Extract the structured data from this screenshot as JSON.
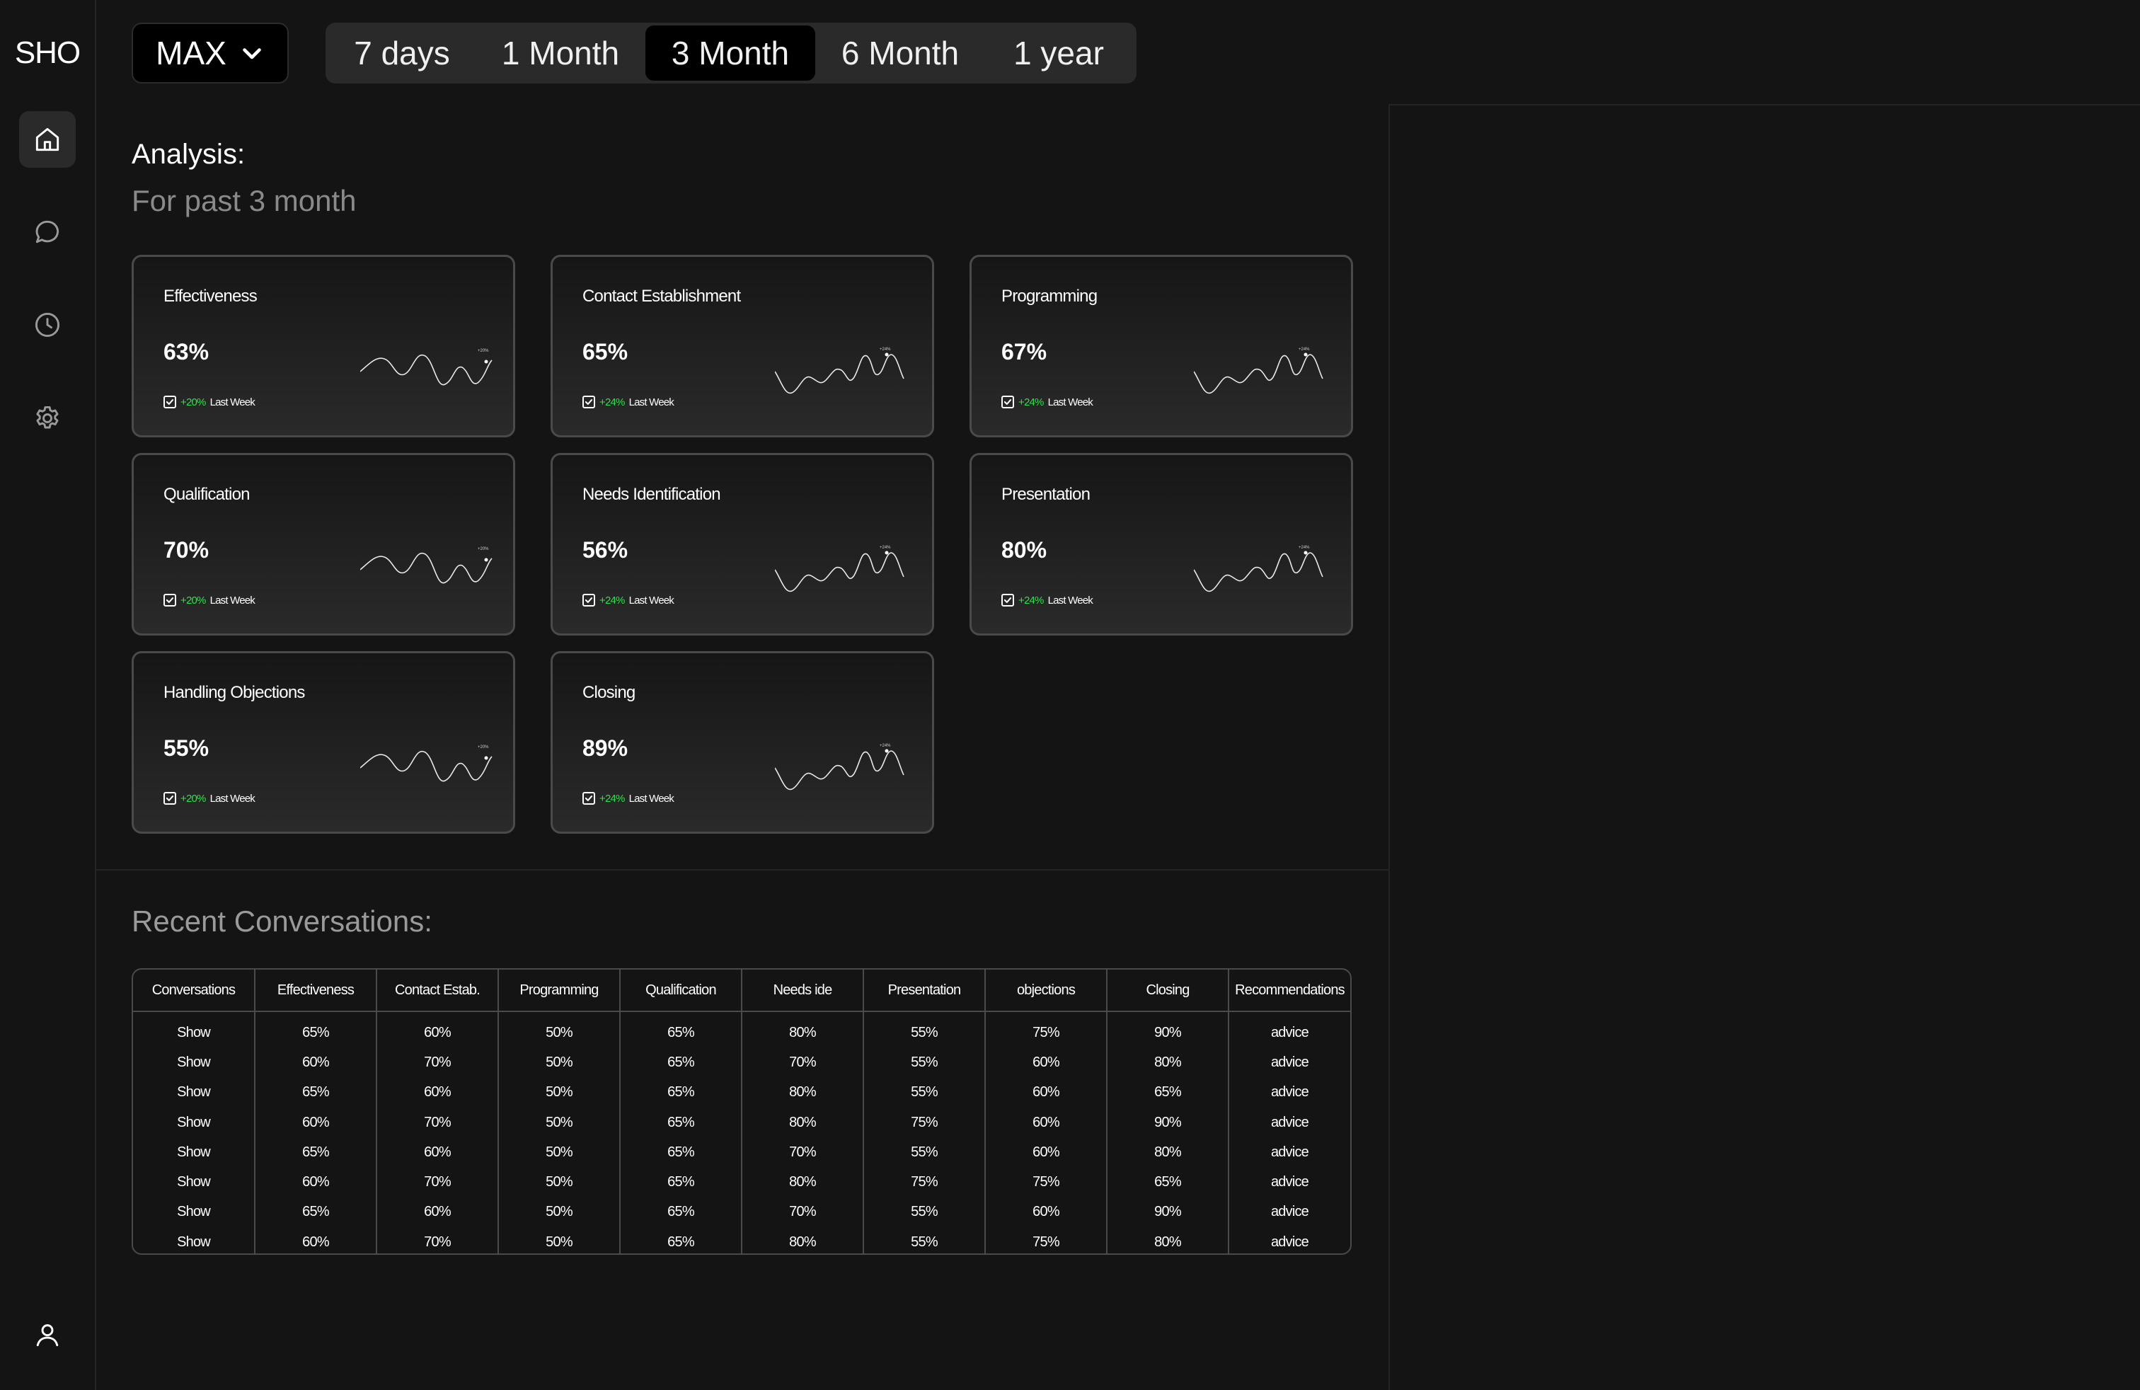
{
  "app": {
    "logo": "SHO"
  },
  "sidebar": {
    "items": [
      {
        "icon": "home-icon",
        "active": true
      },
      {
        "icon": "chat-icon",
        "active": false
      },
      {
        "icon": "clock-icon",
        "active": false
      },
      {
        "icon": "gear-icon",
        "active": false
      },
      {
        "icon": "user-icon",
        "active": false
      }
    ]
  },
  "filters": {
    "max_label": "MAX",
    "periods": [
      "7 days",
      "1 Month",
      "3 Month",
      "6 Month",
      "1 year"
    ],
    "selected_period": "3 Month"
  },
  "analysis": {
    "title": "Analysis:",
    "subtitle": "For past 3 month",
    "cards": [
      {
        "title": "Effectiveness",
        "value": "63%",
        "delta": "+20%",
        "delta_label": "Last Week",
        "spark_tag": "+20%"
      },
      {
        "title": "Contact Establishment",
        "value": "65%",
        "delta": "+24%",
        "delta_label": "Last Week",
        "spark_tag": "+24%"
      },
      {
        "title": "Programming",
        "value": "67%",
        "delta": "+24%",
        "delta_label": "Last Week",
        "spark_tag": "+24%"
      },
      {
        "title": "Qualification",
        "value": "70%",
        "delta": "+20%",
        "delta_label": "Last Week",
        "spark_tag": "+20%"
      },
      {
        "title": "Needs Identification",
        "value": "56%",
        "delta": "+24%",
        "delta_label": "Last Week",
        "spark_tag": "+24%"
      },
      {
        "title": "Presentation",
        "value": "80%",
        "delta": "+24%",
        "delta_label": "Last Week",
        "spark_tag": "+24%"
      },
      {
        "title": "Handling Objections",
        "value": "55%",
        "delta": "+20%",
        "delta_label": "Last Week",
        "spark_tag": "+20%"
      },
      {
        "title": "Closing",
        "value": "89%",
        "delta": "+24%",
        "delta_label": "Last Week",
        "spark_tag": "+24%"
      }
    ]
  },
  "recent": {
    "title": "Recent Conversations:",
    "columns": [
      "Conversations",
      "Effectiveness",
      "Contact Estab.",
      "Programming",
      "Qualification",
      "Needs ide",
      "Presentation",
      "objections",
      "Closing",
      "Recommendations"
    ],
    "rows": [
      [
        "Show",
        "65%",
        "60%",
        "50%",
        "65%",
        "80%",
        "55%",
        "75%",
        "90%",
        "advice"
      ],
      [
        "Show",
        "60%",
        "70%",
        "50%",
        "65%",
        "70%",
        "55%",
        "60%",
        "80%",
        "advice"
      ],
      [
        "Show",
        "65%",
        "60%",
        "50%",
        "65%",
        "80%",
        "55%",
        "60%",
        "65%",
        "advice"
      ],
      [
        "Show",
        "60%",
        "70%",
        "50%",
        "65%",
        "80%",
        "75%",
        "60%",
        "90%",
        "advice"
      ],
      [
        "Show",
        "65%",
        "60%",
        "50%",
        "65%",
        "70%",
        "55%",
        "60%",
        "80%",
        "advice"
      ],
      [
        "Show",
        "60%",
        "70%",
        "50%",
        "65%",
        "80%",
        "75%",
        "75%",
        "65%",
        "advice"
      ],
      [
        "Show",
        "65%",
        "60%",
        "50%",
        "65%",
        "70%",
        "55%",
        "60%",
        "90%",
        "advice"
      ],
      [
        "Show",
        "60%",
        "70%",
        "50%",
        "65%",
        "80%",
        "55%",
        "75%",
        "80%",
        "advice"
      ]
    ]
  }
}
